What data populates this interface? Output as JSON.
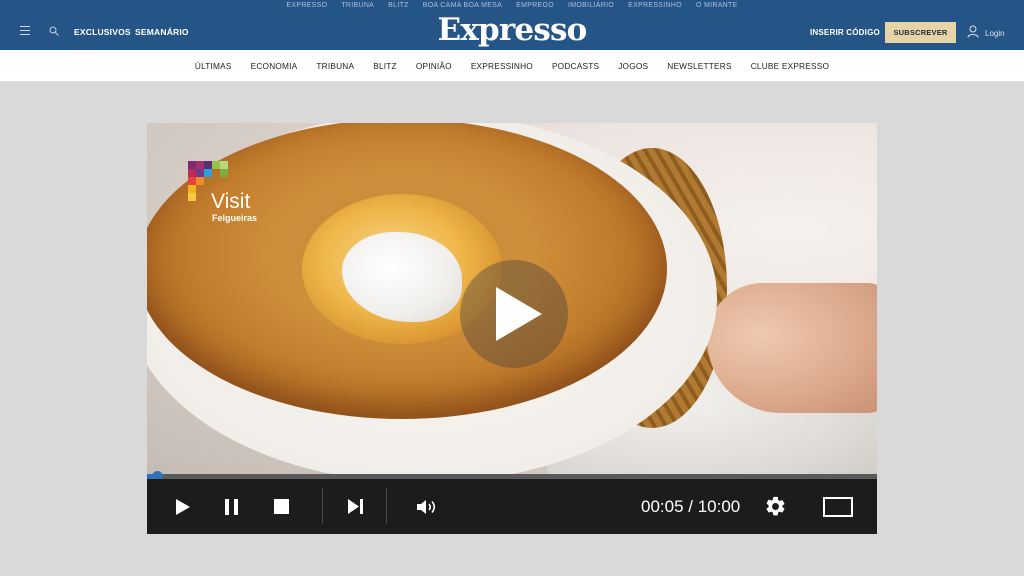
{
  "header": {
    "top_links": [
      "EXPRESSO",
      "TRIBUNA",
      "BLITZ",
      "BOA CAMA BOA MESA",
      "EMPREGO",
      "IMOBILIÁRIO",
      "EXPRESSINHO",
      "O MIRANTE"
    ],
    "exclusivos": "EXCLUSIVOS",
    "semanario": "SEMANÁRIO",
    "logo": "Expresso",
    "inserir_codigo": "INSERIR CÓDIGO",
    "subscrever": "SUBSCREVER",
    "login": "Login"
  },
  "nav": {
    "items": [
      "ÚLTIMAS",
      "ECONOMIA",
      "TRIBUNA",
      "BLITZ",
      "OPINIÃO",
      "EXPRESSINHO",
      "PODCASTS",
      "JOGOS",
      "NEWSLETTERS",
      "CLUBE EXPRESSO"
    ]
  },
  "video": {
    "brand_line1": "Visit",
    "brand_line2": "Felgueiras",
    "progress": 0.0083,
    "time_display": "00:05 / 10:00",
    "colors": {
      "accent": "#2f71b7",
      "header_bg": "#255486",
      "subscribe_bg": "#e7d4a6",
      "page_bg": "#d8d9d8"
    }
  },
  "icons": {
    "menu": "menu-icon",
    "search": "search-icon",
    "user": "user-icon",
    "play": "play-icon",
    "pause": "pause-icon",
    "stop": "stop-icon",
    "next": "skip-next-icon",
    "volume": "volume-icon",
    "settings": "gear-icon",
    "fullscreen": "fullscreen-icon"
  }
}
